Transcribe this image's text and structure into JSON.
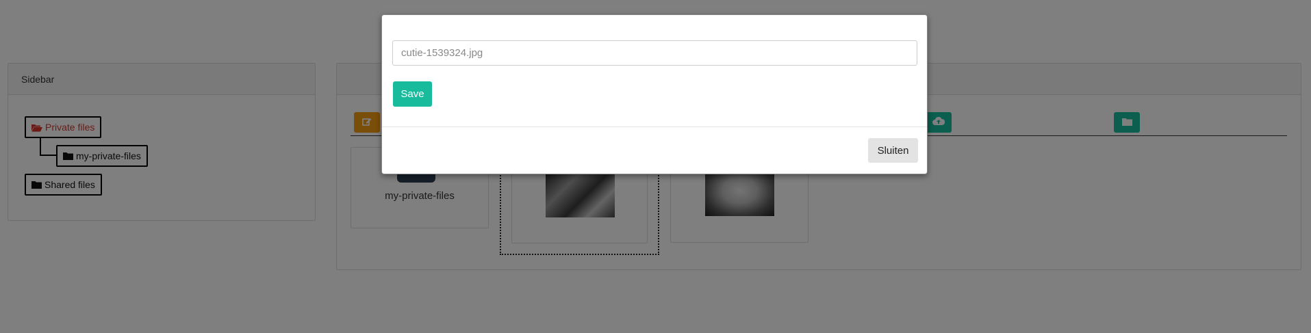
{
  "sidebar": {
    "title": "Sidebar",
    "tree": {
      "private_label": "Private files",
      "private_child_label": "my-private-files",
      "shared_label": "Shared files"
    }
  },
  "main": {
    "toolbar": {
      "edit_icon": "edit-icon",
      "upload_icon": "cloud-upload-icon",
      "folder_icon": "folder-icon"
    },
    "items": [
      {
        "type": "folder",
        "name": "my-private-files"
      },
      {
        "type": "image",
        "icon": "photo-thumbnail"
      },
      {
        "type": "image",
        "icon": "photo-thumbnail"
      }
    ]
  },
  "modal": {
    "filename_value": "cutie-1539324.jpg",
    "save_label": "Save",
    "close_label": "Sluiten"
  },
  "colors": {
    "accent_green": "#18bc9c",
    "warning_orange": "#f39c12",
    "danger_red": "#d9342b",
    "backdrop": "rgba(0,0,0,0.5)"
  }
}
